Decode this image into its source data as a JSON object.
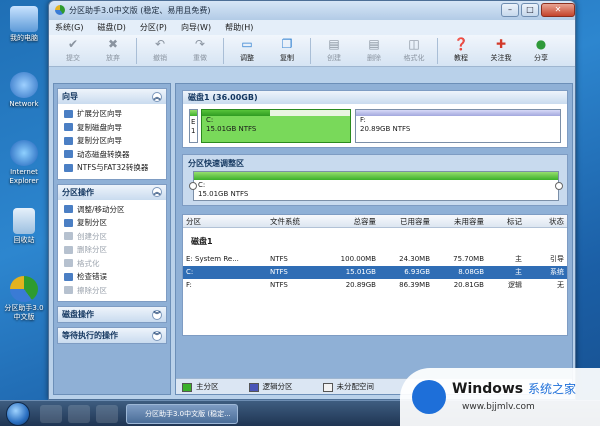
{
  "desktop": {
    "icons": [
      {
        "label": "我的电脑"
      },
      {
        "label": "Network"
      },
      {
        "label": "Internet Explorer"
      },
      {
        "label": "回收站"
      },
      {
        "label": "分区助手3.0中文版"
      }
    ]
  },
  "window": {
    "title": "分区助手3.0中文版 (稳定、易用且免费)",
    "controls": {
      "minimize": "–",
      "maximize": "□",
      "close": "✕"
    }
  },
  "menu": [
    "系统(G)",
    "磁盘(D)",
    "分区(P)",
    "向导(W)",
    "帮助(H)"
  ],
  "toolbar": [
    {
      "label": "提交",
      "icon": "check-icon",
      "glyph": "✔",
      "enabled": false
    },
    {
      "label": "放弃",
      "icon": "discard-icon",
      "glyph": "✖",
      "enabled": false
    },
    {
      "label": "撤销",
      "icon": "undo-icon",
      "glyph": "↶",
      "enabled": false
    },
    {
      "label": "重做",
      "icon": "redo-icon",
      "glyph": "↷",
      "enabled": false
    },
    {
      "label": "调整",
      "icon": "resize-icon",
      "glyph": "▭",
      "enabled": true
    },
    {
      "label": "复制",
      "icon": "copy-icon",
      "glyph": "❐",
      "enabled": true
    },
    {
      "label": "创建",
      "icon": "create-icon",
      "glyph": "▤",
      "enabled": false
    },
    {
      "label": "删除",
      "icon": "delete-icon",
      "glyph": "▤",
      "enabled": false
    },
    {
      "label": "格式化",
      "icon": "format-icon",
      "glyph": "◫",
      "enabled": false
    },
    {
      "label": "教程",
      "icon": "tutorial-icon",
      "glyph": "❓",
      "enabled": true
    },
    {
      "label": "关注我",
      "icon": "follow-icon",
      "glyph": "✚",
      "enabled": true
    },
    {
      "label": "分享",
      "icon": "share-icon",
      "glyph": "●",
      "enabled": true
    }
  ],
  "sidebar": {
    "wizard": {
      "title": "向导",
      "items": [
        {
          "label": "扩展分区向导",
          "enabled": true
        },
        {
          "label": "复制磁盘向导",
          "enabled": true
        },
        {
          "label": "复制分区向导",
          "enabled": true
        },
        {
          "label": "动态磁盘转换器",
          "enabled": true
        },
        {
          "label": "NTFS与FAT32转换器",
          "enabled": true
        }
      ]
    },
    "partition_ops": {
      "title": "分区操作",
      "items": [
        {
          "label": "调整/移动分区",
          "enabled": true
        },
        {
          "label": "复制分区",
          "enabled": true
        },
        {
          "label": "创建分区",
          "enabled": false
        },
        {
          "label": "删除分区",
          "enabled": false
        },
        {
          "label": "格式化",
          "enabled": false
        },
        {
          "label": "检查错误",
          "enabled": true
        },
        {
          "label": "擦除分区",
          "enabled": false
        }
      ]
    },
    "disk_ops": {
      "title": "磁盘操作"
    },
    "pending_ops": {
      "title": "等待执行的操作"
    }
  },
  "disk_map": {
    "header": "磁盘1 (36.00GB)",
    "sys_part": {
      "line1": "E",
      "line2": "1"
    },
    "partitions": [
      {
        "name": "C:",
        "info": "15.01GB NTFS",
        "fill": 0.46
      },
      {
        "name": "F:",
        "info": "20.89GB NTFS",
        "fill": 0.0
      }
    ]
  },
  "resize_panel": {
    "title": "分区快速调整区",
    "name": "C:",
    "info": "15.01GB NTFS"
  },
  "table": {
    "headers": [
      "分区",
      "文件系统",
      "总容量",
      "已用容量",
      "未用容量",
      "标记",
      "状态"
    ],
    "disk_label": "磁盘1",
    "rows": [
      {
        "partition": "E: System Re...",
        "fs": "NTFS",
        "total": "100.00MB",
        "used": "24.30MB",
        "free": "75.70MB",
        "flag": "主",
        "status": "引导",
        "selected": false
      },
      {
        "partition": "C:",
        "fs": "NTFS",
        "total": "15.01GB",
        "used": "6.93GB",
        "free": "8.08GB",
        "flag": "主",
        "status": "系统",
        "selected": true
      },
      {
        "partition": "F:",
        "fs": "NTFS",
        "total": "20.89GB",
        "used": "86.39MB",
        "free": "20.81GB",
        "flag": "逻辑",
        "status": "无",
        "selected": false
      }
    ]
  },
  "legend": [
    {
      "label": "主分区",
      "color": "#3bb02a"
    },
    {
      "label": "逻辑分区",
      "color": "#4a55b8"
    },
    {
      "label": "未分配空间",
      "color": "#f2f2f2"
    }
  ],
  "taskbar": {
    "active_window": "分区助手3.0中文版 (稳定..."
  },
  "watermark": {
    "brand": "Windows",
    "subtitle": "系统之家",
    "url": "www.bjjmlv.com"
  }
}
